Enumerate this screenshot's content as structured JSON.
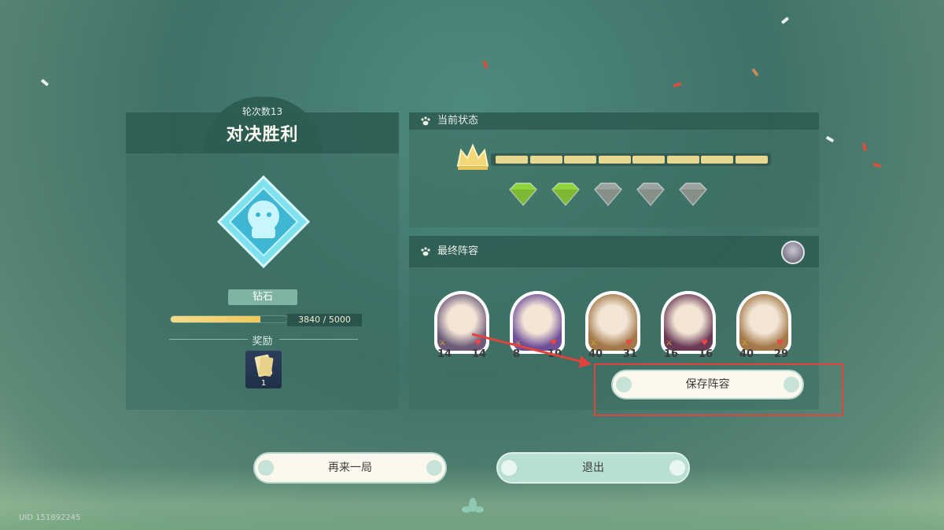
{
  "result": {
    "round_label": "轮次数13",
    "title": "对决胜利",
    "rank_name": "钻石",
    "xp_text": "3840 / 5000",
    "xp_fraction": 0.768,
    "reward_label": "奖励",
    "reward_count": "1"
  },
  "status": {
    "header": "当前状态",
    "progress_segments_total": 8,
    "progress_segments_filled": 8,
    "gems_total": 5,
    "gems_green": 2
  },
  "lineup": {
    "header": "最终阵容",
    "units": [
      {
        "name": "unit-1",
        "atk": "14",
        "hp": "14",
        "color": "#6d5a78"
      },
      {
        "name": "unit-2",
        "atk": "8",
        "hp": "10",
        "color": "#6f4f9a"
      },
      {
        "name": "unit-3",
        "atk": "40",
        "hp": "31",
        "color": "#a27848"
      },
      {
        "name": "unit-4",
        "atk": "16",
        "hp": "16",
        "color": "#6a3a55"
      },
      {
        "name": "unit-5",
        "atk": "40",
        "hp": "29",
        "color": "#a27848"
      }
    ],
    "save_label": "保存阵容"
  },
  "actions": {
    "again_label": "再来一局",
    "exit_label": "退出"
  },
  "footer": {
    "uid": "UID 151892245"
  },
  "colors": {
    "highlight": "#e0443c",
    "gem_green": "#8fd33b",
    "gem_grey": "#9aa39d",
    "progress": "#e7d890"
  }
}
